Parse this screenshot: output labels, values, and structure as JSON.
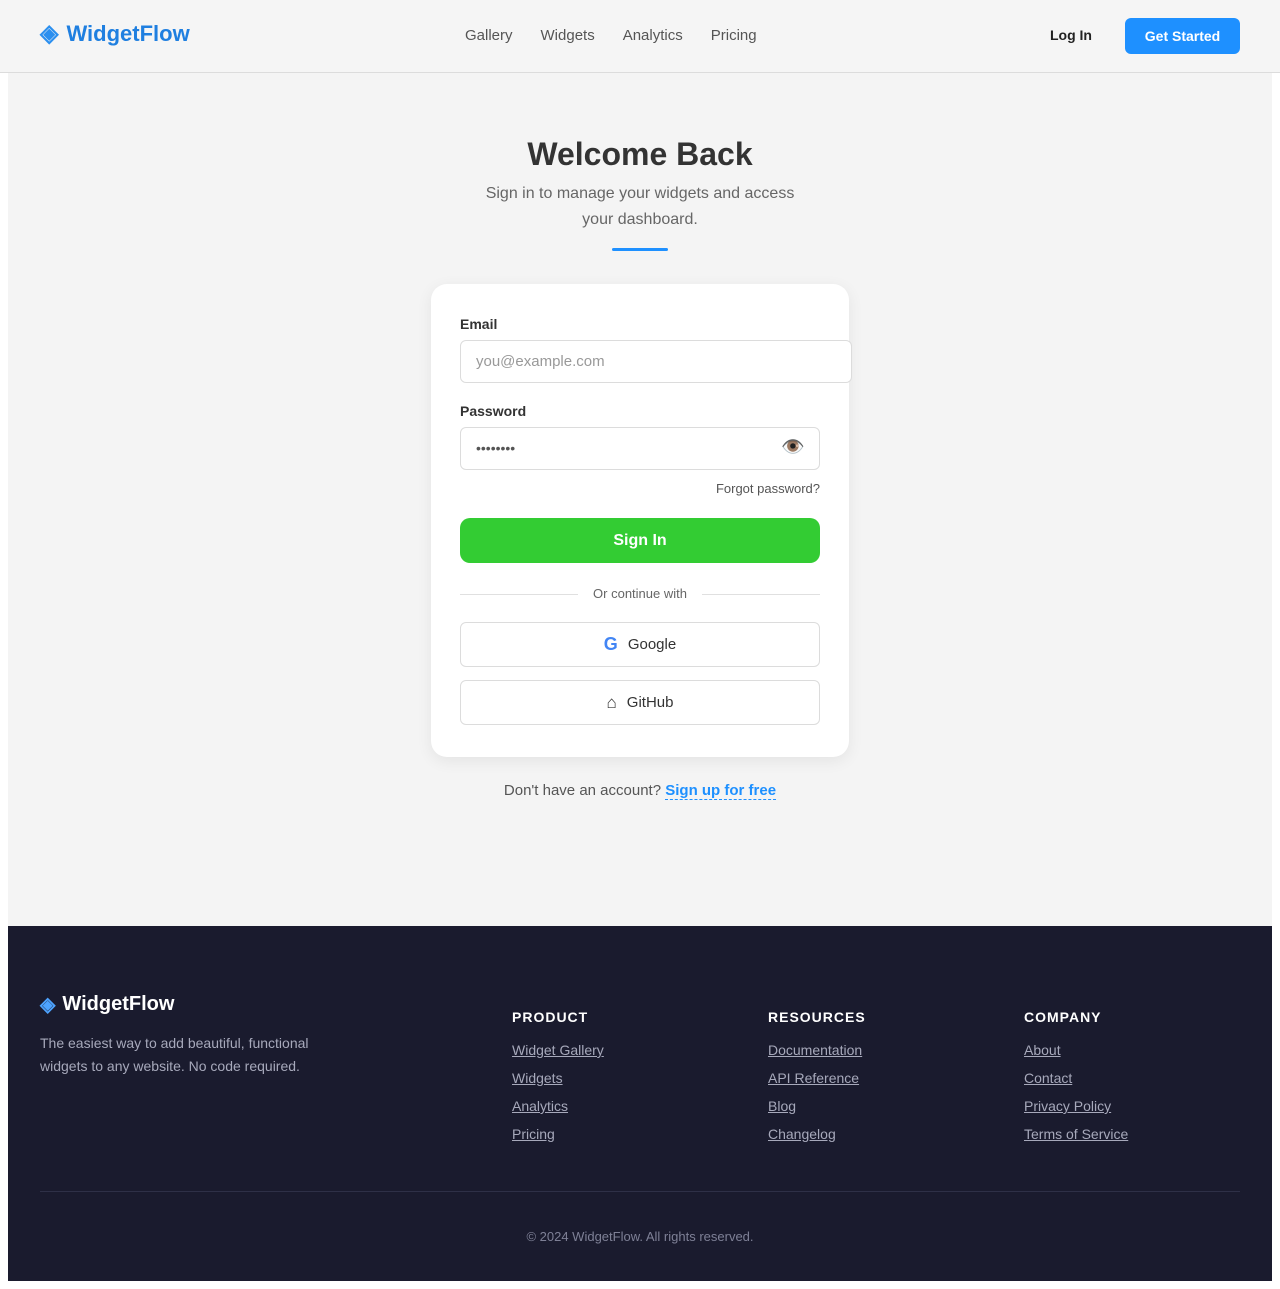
{
  "header": {
    "logo_icon": "◈",
    "logo_text": "WidgetFlow",
    "nav": [
      "Gallery",
      "Widgets",
      "Analytics",
      "Pricing"
    ],
    "login_label": "Log In",
    "cta_label": "Get Started"
  },
  "hero": {
    "title": "Welcome Back",
    "subtitle": "Sign in to manage your widgets and access your dashboard."
  },
  "form": {
    "email_label": "Email",
    "email_placeholder": "you@example.com",
    "password_label": "Password",
    "password_value": "••••••••",
    "eye_icon": "👁️",
    "forgot_label": "Forgot password?",
    "signin_label": "Sign In",
    "divider_text": "Or continue with",
    "google_icon": "G",
    "google_label": "Google",
    "github_icon": "⌂",
    "github_label": "GitHub",
    "signup_prompt": "Don't have an account?",
    "signup_link": "Sign up for free"
  },
  "footer": {
    "logo_icon": "◈",
    "logo_text": "WidgetFlow",
    "tagline": "The easiest way to add beautiful, functional widgets to any website. No code required.",
    "columns": [
      {
        "heading": "PRODUCT",
        "items": [
          "Widget Gallery",
          "Widgets",
          "Analytics",
          "Pricing"
        ]
      },
      {
        "heading": "RESOURCES",
        "items": [
          "Documentation",
          "API Reference",
          "Blog",
          "Changelog"
        ]
      },
      {
        "heading": "COMPANY",
        "items": [
          "About",
          "Contact",
          "Privacy Policy",
          "Terms of Service"
        ]
      }
    ],
    "copyright": "© 2024 WidgetFlow. All rights reserved."
  },
  "colors": {
    "accent": "#1e90ff",
    "signin_button": "#33cc33",
    "footer_bg": "#1a1b2e"
  }
}
